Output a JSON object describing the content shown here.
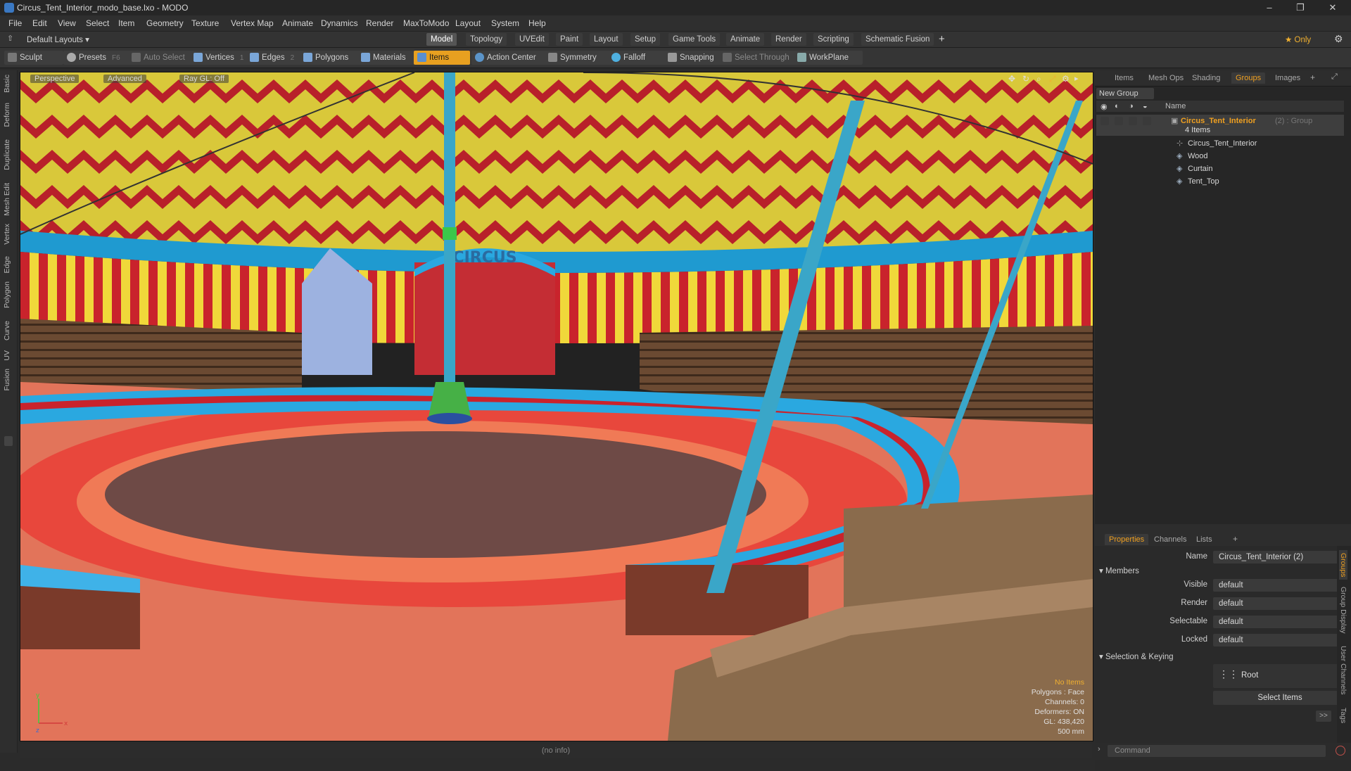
{
  "window": {
    "title": "Circus_Tent_Interior_modo_base.lxo - MODO",
    "minimize": "–",
    "maximize": "❐",
    "close": "✕"
  },
  "menu": [
    "File",
    "Edit",
    "View",
    "Select",
    "Item",
    "Geometry",
    "Texture",
    "Vertex Map",
    "Animate",
    "Dynamics",
    "Render",
    "MaxToModo",
    "Layout",
    "System",
    "Help"
  ],
  "layoutbar": {
    "layouts_label": "Default Layouts ▾",
    "tabs": [
      "Model",
      "Topology",
      "UVEdit",
      "Paint",
      "Layout",
      "Setup",
      "Game Tools",
      "Animate",
      "Render",
      "Scripting",
      "Schematic Fusion"
    ],
    "active_tab": "Model",
    "plus": "+",
    "only_label": "★  Only"
  },
  "toolbar": {
    "sculpt": "Sculpt",
    "presets": "Presets",
    "presets_key": "F6",
    "auto_select": "Auto Select",
    "vertices": "Vertices",
    "vertices_key": "1",
    "edges": "Edges",
    "edges_key": "2",
    "polygons": "Polygons",
    "materials": "Materials",
    "items": "Items",
    "action_center": "Action Center",
    "symmetry": "Symmetry",
    "falloff": "Falloff",
    "snapping": "Snapping",
    "select_through": "Select Through",
    "workplane": "WorkPlane"
  },
  "left_tabs": [
    "Basic",
    "Deform",
    "Duplicate",
    "Mesh Edit",
    "Vertex",
    "Edge",
    "Polygon",
    "Curve",
    "UV",
    "Fusion"
  ],
  "viewport": {
    "view_mode": "Perspective",
    "shading": "Advanced",
    "raygl": "Ray GL: Off",
    "sign_text": "CIRCUS",
    "info": {
      "selection": "No Items",
      "polygons": "Polygons : Face",
      "channels": "Channels: 0",
      "deformers": "Deformers: ON",
      "gl": "GL: 438,420",
      "scale": "500 mm"
    },
    "axis_x": "x",
    "axis_y": "y",
    "axis_z": "z"
  },
  "status_bar": "(no info)",
  "right_panel": {
    "top_tabs": [
      "Items",
      "Mesh Ops",
      "Shading",
      "Groups",
      "Images"
    ],
    "active_top_tab": "Groups",
    "new_group": "New Group",
    "tree_header_name": "Name",
    "group": {
      "name": "Circus_Tent_Interior",
      "suffix": "(2) : Group",
      "count": "4 Items",
      "children": [
        "Circus_Tent_Interior",
        "Wood",
        "Curtain",
        "Tent_Top"
      ]
    },
    "bottom_tabs": [
      "Properties",
      "Channels",
      "Lists"
    ],
    "active_bottom_tab": "Properties",
    "properties": {
      "name_label": "Name",
      "name_value": "Circus_Tent_Interior (2)",
      "members_section": "Members",
      "visible_label": "Visible",
      "visible_value": "default",
      "render_label": "Render",
      "render_value": "default",
      "selectable_label": "Selectable",
      "selectable_value": "default",
      "locked_label": "Locked",
      "locked_value": "default",
      "selkey_section": "Selection & Keying",
      "root_label": "Root",
      "select_items": "Select Items",
      "more": ">>"
    },
    "side_tabs": [
      "Groups",
      "Group Display",
      "User Channels",
      "Tags"
    ],
    "command_placeholder": "Command"
  }
}
